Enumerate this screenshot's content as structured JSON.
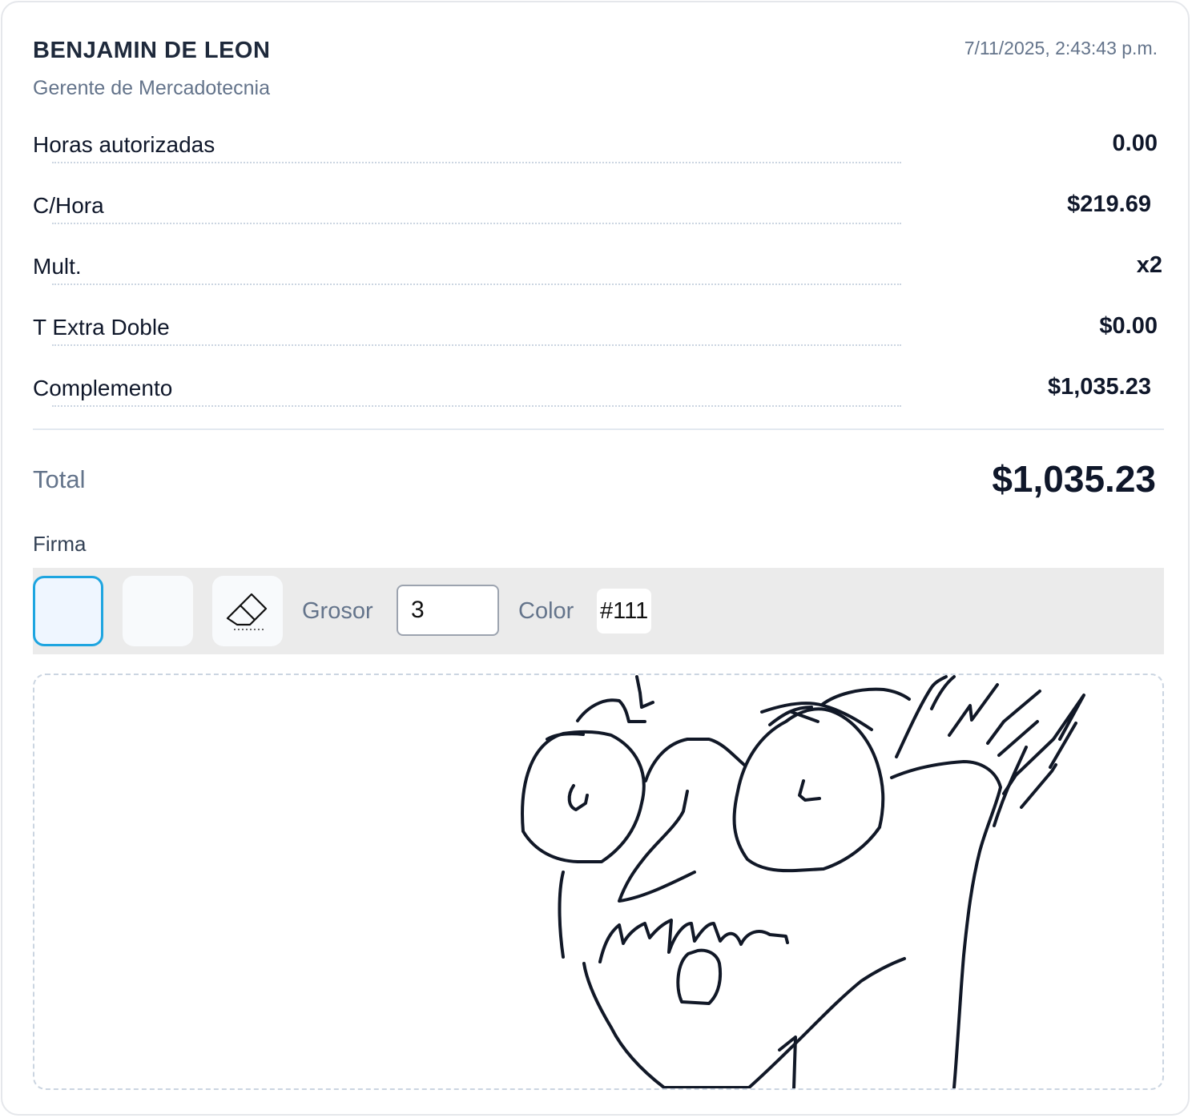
{
  "employee": {
    "name": "BENJAMIN DE LEON",
    "role": "Gerente de Mercadotecnia",
    "timestamp": "7/11/2025, 2:43:43 p.m."
  },
  "rows": [
    {
      "label": "Horas autorizadas",
      "value": "0.00"
    },
    {
      "label": "C/Hora",
      "value": "$219.69"
    },
    {
      "label": "Mult.",
      "value": "x2"
    },
    {
      "label": "T Extra Doble",
      "value": "$0.00"
    },
    {
      "label": "Complemento",
      "value": "$1,035.23"
    }
  ],
  "total": {
    "label": "Total",
    "value": "$1,035.23"
  },
  "signature": {
    "label": "Firma",
    "toolbar": {
      "pen_tool": "pen-tool",
      "highlighter_tool": "blank-tool",
      "eraser_tool": "eraser-icon",
      "thickness_label": "Grosor",
      "thickness_value": "3",
      "color_label": "Color",
      "color_value": "#111"
    },
    "stroke_color": "#111827"
  },
  "colors": {
    "active_border": "#1ea5e0",
    "muted_text": "#64748b",
    "toolbar_bg": "#ebebeb"
  }
}
